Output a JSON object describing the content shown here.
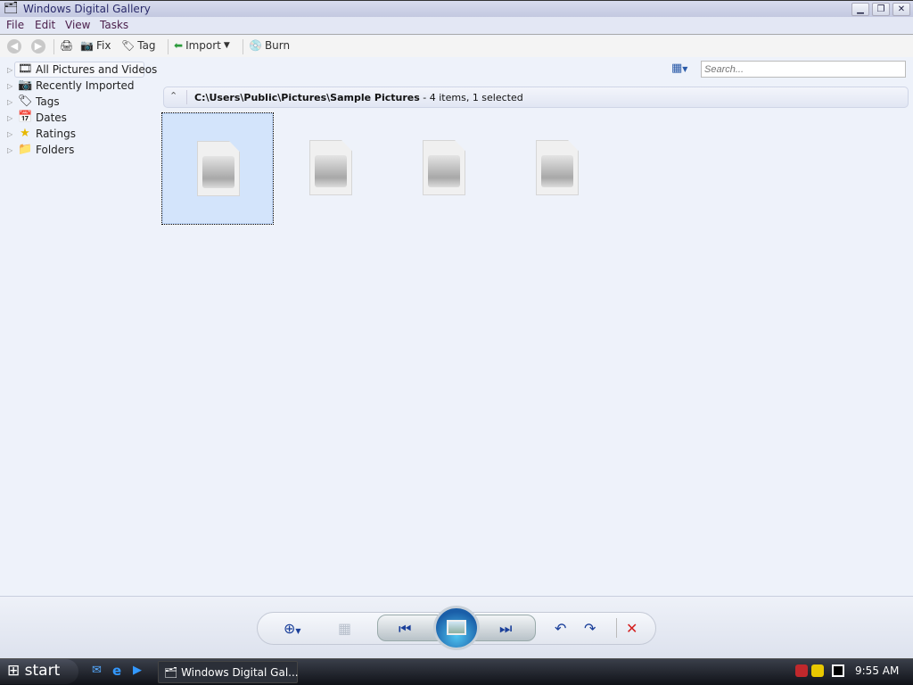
{
  "window": {
    "title": "Windows Digital Gallery"
  },
  "menu": [
    "File",
    "Edit",
    "View",
    "Tasks"
  ],
  "toolbar": {
    "fix": "Fix",
    "tag": "Tag",
    "import": "Import",
    "burn": "Burn"
  },
  "tree": [
    {
      "label": "All Pictures and Videos",
      "selected": true
    },
    {
      "label": "Recently Imported"
    },
    {
      "label": "Tags"
    },
    {
      "label": "Dates"
    },
    {
      "label": "Ratings"
    },
    {
      "label": "Folders"
    }
  ],
  "search": {
    "placeholder": "Search..."
  },
  "path": {
    "location": "C:\\Users\\Public\\Pictures\\Sample Pictures",
    "summary": " - 4 items, 1 selected"
  },
  "items": [
    {
      "selected": true
    },
    {
      "selected": false
    },
    {
      "selected": false
    },
    {
      "selected": false
    }
  ],
  "taskbar": {
    "start": "start",
    "window_item": "Windows Digital Gal...",
    "clock": "9:55 AM"
  }
}
